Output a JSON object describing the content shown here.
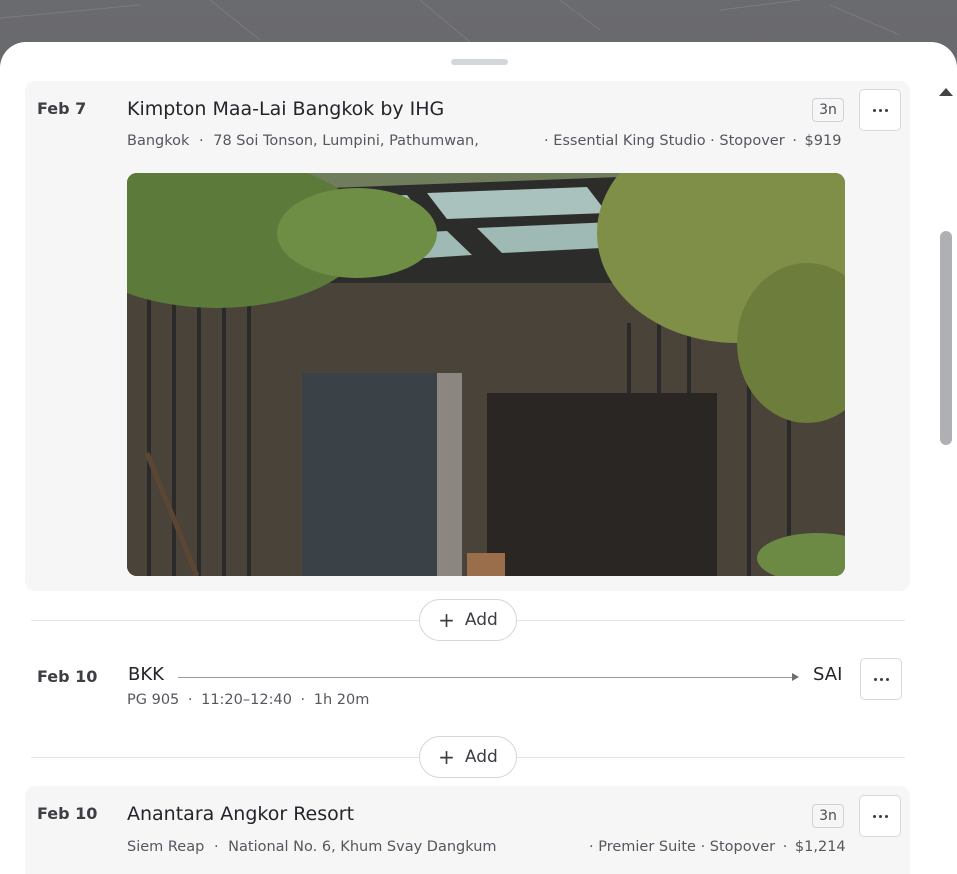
{
  "colors": {
    "sheet_background": "#ffffff",
    "card_background": "#f6f6f6",
    "text_primary": "#23252b",
    "text_secondary": "#54575e",
    "border": "#d3d6da"
  },
  "add_label": "Add",
  "hotel_1": {
    "date": "Feb 7",
    "name": "Kimpton Maa-Lai Bangkok by IHG",
    "nights": "3n",
    "city": "Bangkok",
    "address": "78 Soi Tonson, Lumpini, Pathumwan,",
    "room": "Essential King Studio",
    "type": "Stopover",
    "price": "$919",
    "more_icon": "more-horizontal-icon"
  },
  "flight": {
    "date": "Feb 10",
    "from": "BKK",
    "to": "SAI",
    "number": "PG 905",
    "times": "11:20–12:40",
    "duration": "1h 20m",
    "more_icon": "more-horizontal-icon"
  },
  "hotel_2": {
    "date": "Feb 10",
    "name": "Anantara Angkor Resort",
    "nights": "3n",
    "city": "Siem Reap",
    "address": "National No. 6, Khum Svay Dangkum",
    "room": "Premier Suite",
    "type": "Stopover",
    "price": "$1,214",
    "more_icon": "more-horizontal-icon"
  }
}
